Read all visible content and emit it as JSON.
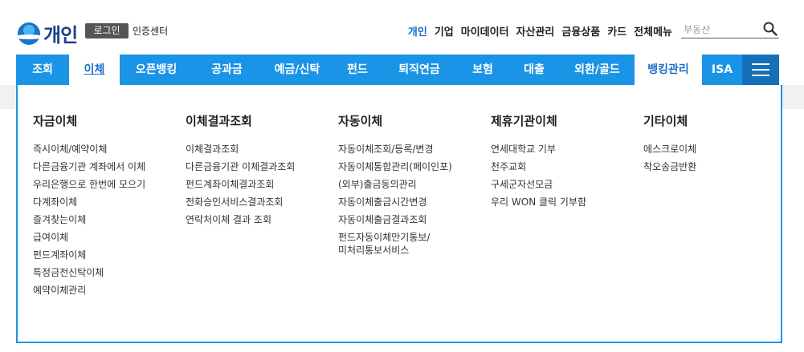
{
  "header": {
    "logo_text": "개인",
    "login_label": "로그인",
    "cert_center": "인증센터",
    "top_nav": [
      "개인",
      "기업",
      "마이데이터",
      "자산관리",
      "금융상품",
      "카드",
      "전체메뉴"
    ],
    "active_top": "개인",
    "search_placeholder": "부동산"
  },
  "menu": {
    "items": [
      "조회",
      "이체",
      "오픈뱅킹",
      "공과금",
      "예금/신탁",
      "펀드",
      "퇴직연금",
      "보험",
      "대출",
      "외환/골드",
      "뱅킹관리",
      "ISA"
    ],
    "active": "이체"
  },
  "dropdown": {
    "columns": [
      {
        "title": "자금이체",
        "items": [
          "즉시이체/예약이체",
          "다른금융기관 계좌에서 이체",
          "우리은행으로 한번에 모으기",
          "다계좌이체",
          "즐겨찾는이체",
          "급여이체",
          "펀드계좌이체",
          "특정금전신탁이체",
          "예약이체관리"
        ]
      },
      {
        "title": "이체결과조회",
        "items": [
          "이체결과조회",
          "다른금융기관 이체결과조회",
          "펀드계좌이체결과조회",
          "전화승인서비스결과조회",
          "연락처이체 결과 조회"
        ]
      },
      {
        "title": "자동이체",
        "items": [
          "자동이체조회/등록/변경",
          "자동이체통합관리(페이인포)",
          "(외부)출금동의관리",
          "자동이체출금시간변경",
          "자동이체출금결과조회",
          "펀드자동이체만기통보/",
          "미처리통보서비스"
        ]
      },
      {
        "title": "제휴기관이체",
        "items": [
          "연세대학교 기부",
          "천주교회",
          "구세군자선모금",
          "우리 WON 클릭 기부함"
        ]
      },
      {
        "title": "기타이체",
        "items": [
          "에스크로이체",
          "착오송금반환"
        ]
      }
    ]
  },
  "colors": {
    "menu_blue": "#1a94e6",
    "hamburger_blue": "#1470b8",
    "accent_text": "#1a6fc9"
  }
}
